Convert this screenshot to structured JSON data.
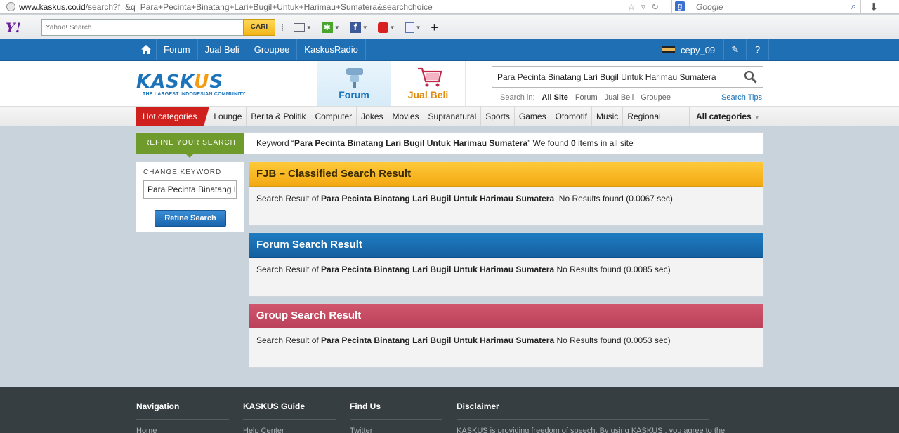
{
  "browser": {
    "url_host": "www.kaskus.co.id",
    "url_path": "/search?f=&q=Para+Pecinta+Binatang+Lari+Bugil+Untuk+Harimau+Sumatera&searchchoice=",
    "search_engine_placeholder": "Google"
  },
  "yahoo_toolbar": {
    "logo": "Y!",
    "search_placeholder": "Yahoo! Search",
    "button": "CARI"
  },
  "topnav": {
    "items": [
      "Forum",
      "Jual Beli",
      "Groupee",
      "KaskusRadio"
    ],
    "username": "cepy_09"
  },
  "header": {
    "logo_word_pre": "KASK",
    "logo_word_u": "U",
    "logo_word_post": "S",
    "logo_tagline": "THE LARGEST INDONESIAN COMMUNITY",
    "tab_forum": "Forum",
    "tab_jualbeli": "Jual Beli",
    "search_value": "Para Pecinta Binatang Lari Bugil Untuk Harimau Sumatera",
    "search_in_label": "Search in:",
    "search_in_options": [
      "All Site",
      "Forum",
      "Jual Beli",
      "Groupee"
    ],
    "search_tips": "Search Tips"
  },
  "categories": {
    "hot": "Hot categories",
    "items": [
      "Lounge",
      "Berita & Politik",
      "Computer",
      "Jokes",
      "Movies",
      "Supranatural",
      "Sports",
      "Games",
      "Otomotif",
      "Music",
      "Regional"
    ],
    "all": "All categories"
  },
  "refine": {
    "label": "REFINE YOUR SEARCH",
    "kw_prefix": "Keyword “",
    "keyword": "Para Pecinta Binatang Lari Bugil Untuk Harimau Sumatera",
    "kw_mid": "” We found ",
    "count": "0",
    "kw_suffix": " items in all site"
  },
  "sidebar": {
    "title": "CHANGE KEYWORD",
    "input_value": "Para Pecinta Binatang Lari Bugil Untuk Harimau Sumatera",
    "button": "Refine Search"
  },
  "results": {
    "prefix": "Search Result of ",
    "keyword": "Para Pecinta Binatang Lari Bugil Untuk Harimau Sumatera",
    "fjb": {
      "title": "FJB – Classified Search Result",
      "status": "  No Results found (0.0067 sec)"
    },
    "forum": {
      "title": "Forum Search Result",
      "status": " No Results found (0.0085 sec)"
    },
    "group": {
      "title": "Group Search Result",
      "status": " No Results found (0.0053 sec)"
    }
  },
  "footer": {
    "navigation": {
      "title": "Navigation",
      "first": "Home"
    },
    "guide": {
      "title": "KASKUS Guide",
      "first": "Help Center"
    },
    "findus": {
      "title": "Find Us",
      "first": "Twitter"
    },
    "disclaimer": {
      "title": "Disclaimer",
      "text": "KASKUS is providing freedom of speech. By using KASKUS , you agree to the"
    }
  },
  "colors": {
    "brand_blue": "#1f6fb5",
    "refine_green": "#6f9b2c",
    "fjb_yellow": "#f2a912",
    "group_pink": "#bb4059",
    "hot_red": "#d0201d"
  }
}
